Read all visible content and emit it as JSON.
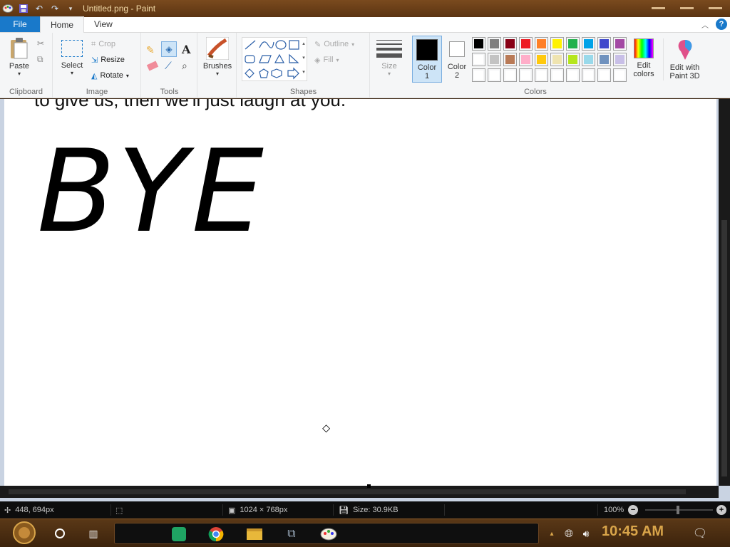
{
  "titlebar": {
    "title": "Untitled.png - Paint"
  },
  "tabs": {
    "file": "File",
    "home": "Home",
    "view": "View",
    "help": "?"
  },
  "ribbon": {
    "clipboard": {
      "paste": "Paste",
      "label": "Clipboard"
    },
    "image": {
      "select": "Select",
      "crop": "Crop",
      "resize": "Resize",
      "rotate": "Rotate",
      "label": "Image"
    },
    "tools": {
      "label": "Tools"
    },
    "brushes": {
      "label": "Brushes"
    },
    "shapes": {
      "outline": "Outline",
      "fill": "Fill",
      "label": "Shapes"
    },
    "size": {
      "label": "Size"
    },
    "color1": {
      "line1": "Color",
      "line2": "1"
    },
    "color2": {
      "line1": "Color",
      "line2": "2"
    },
    "colors": {
      "label": "Colors"
    },
    "edit_colors": {
      "line1": "Edit",
      "line2": "colors"
    },
    "paint3d": {
      "line1": "Edit with",
      "line2": "Paint 3D"
    },
    "palette_row1": [
      "#000000",
      "#7f7f7f",
      "#880015",
      "#ed1c24",
      "#ff7f27",
      "#fff200",
      "#22b14c",
      "#00a2e8",
      "#3f48cc",
      "#a349a4"
    ],
    "palette_row2": [
      "#ffffff",
      "#c3c3c3",
      "#b97a57",
      "#ffaec9",
      "#ffc90e",
      "#efe4b0",
      "#b5e61d",
      "#99d9ea",
      "#7092be",
      "#c8bfe7"
    ],
    "palette_row3": [
      "#ffffff",
      "#ffffff",
      "#ffffff",
      "#ffffff",
      "#ffffff",
      "#ffffff",
      "#ffffff",
      "#ffffff",
      "#ffffff",
      "#ffffff"
    ]
  },
  "canvas": {
    "cut_text": "to give us, then we'll just laugh at you.",
    "big_text": "BYE"
  },
  "statusbar": {
    "cursor_pos": "448, 694px",
    "dimensions": "1024 × 768px",
    "size": "Size: 30.9KB",
    "zoom": "100%"
  },
  "taskbar": {
    "clock": "10:45 AM"
  }
}
